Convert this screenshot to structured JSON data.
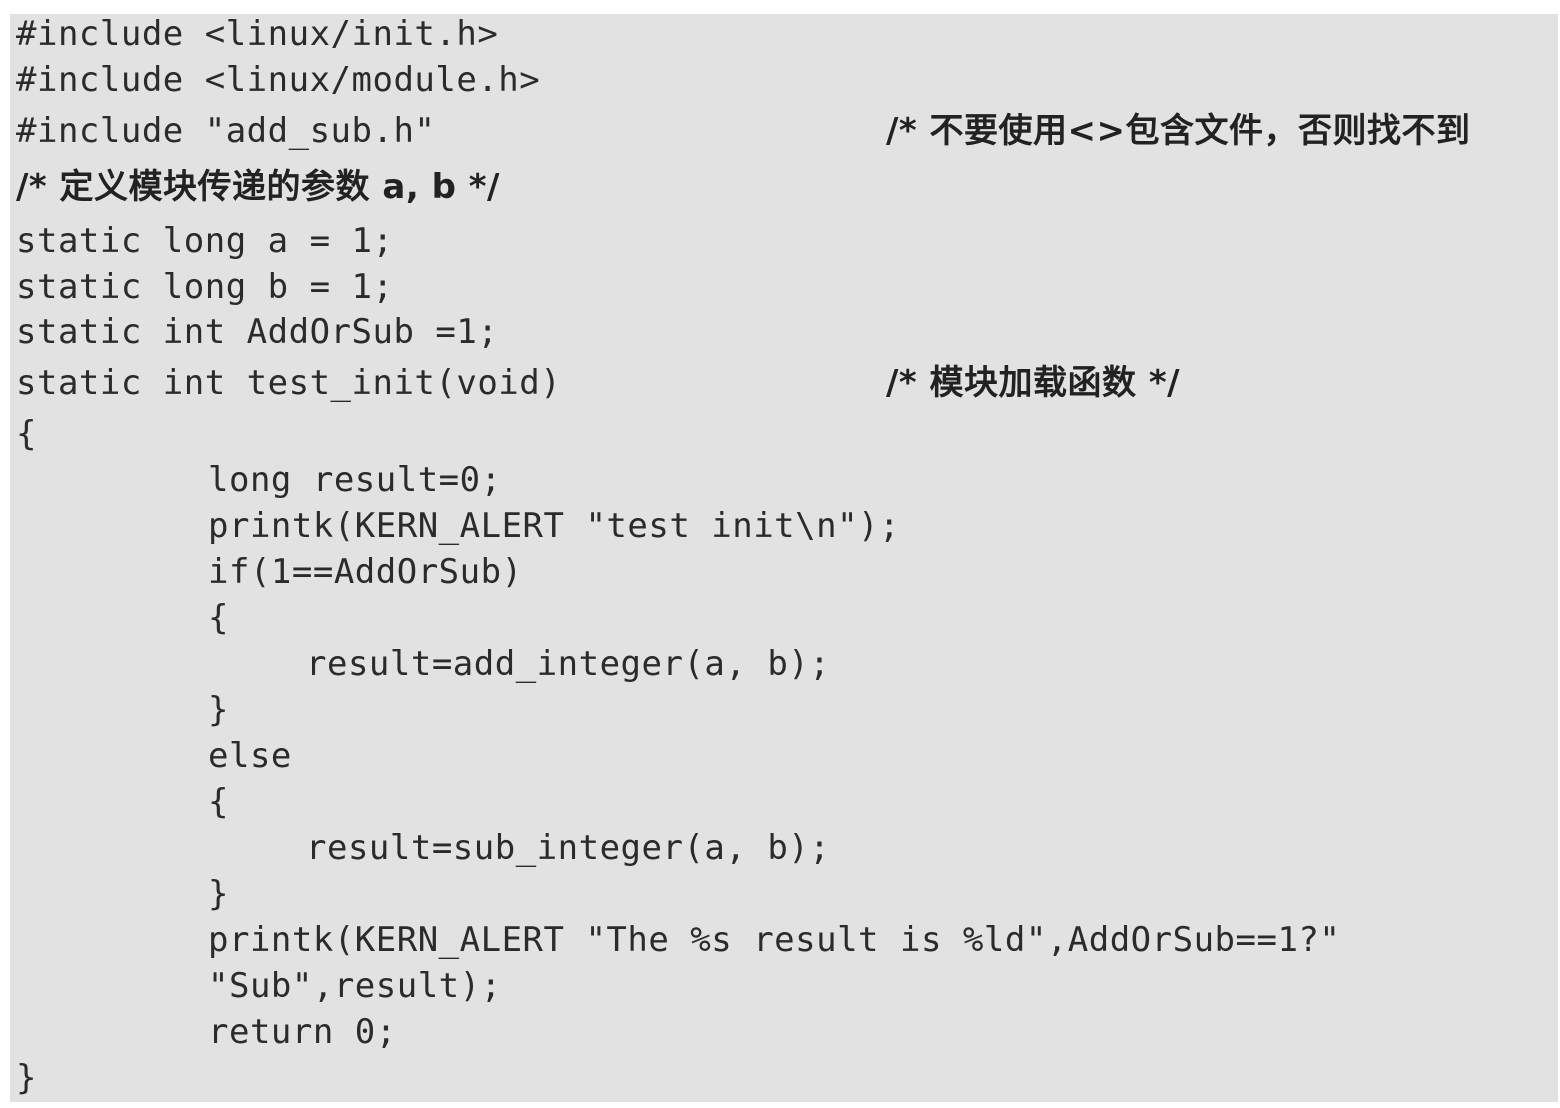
{
  "code": {
    "l01": "#include <linux/init.h>",
    "l02": "#include <linux/module.h>",
    "l03": "#include \"add_sub.h\"",
    "l03_comment": "/* 不要使用<>包含文件，否则找不到",
    "l04": "/* 定义模块传递的参数 a, b */",
    "l05": "static long a = 1;",
    "l06": "static long b = 1;",
    "l07": "static int AddOrSub =1;",
    "l08": "static int test_init(void)",
    "l08_comment": "/* 模块加载函数 */",
    "l09": "{",
    "l10": "long result=0;",
    "l11": "printk(KERN_ALERT \"test init\\n\");",
    "l12": "if(1==AddOrSub)",
    "l13": "{",
    "l14": "result=add_integer(a, b);",
    "l15": "}",
    "l16": "else",
    "l17": "{",
    "l18": "result=sub_integer(a, b);",
    "l19": "}",
    "l20": "printk(KERN_ALERT \"The %s result is %ld\",AddOrSub==1?\"",
    "l21": "\"Sub\",result);",
    "l22": "return 0;",
    "l23": "}"
  }
}
